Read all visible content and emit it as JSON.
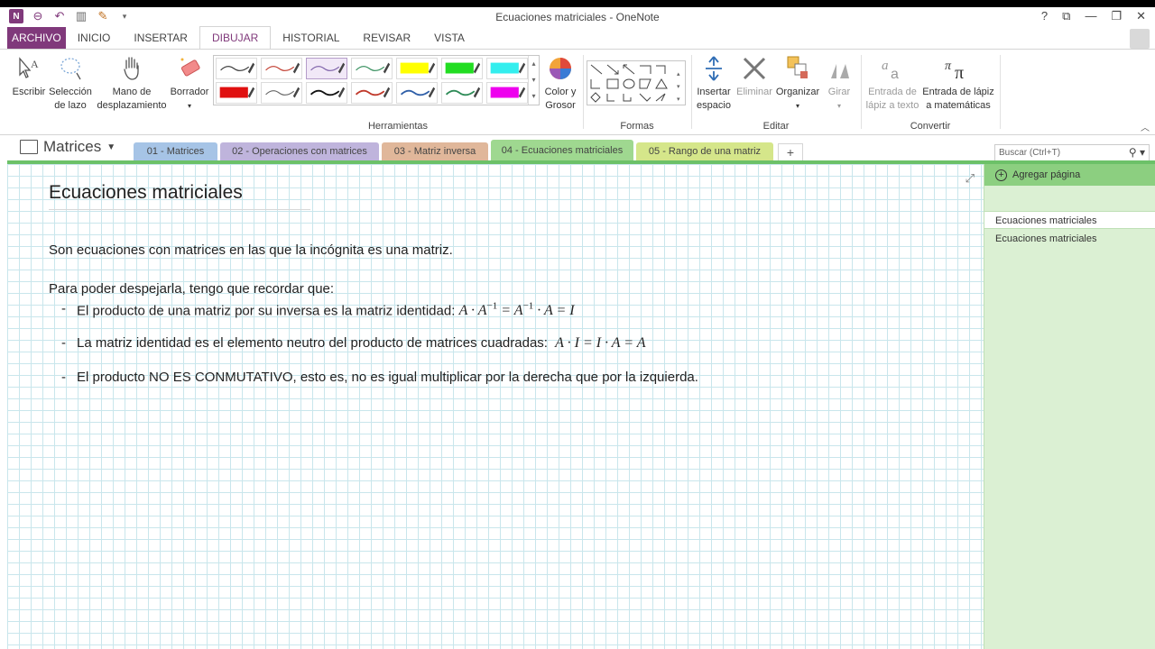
{
  "window": {
    "title": "Ecuaciones matriciales - OneNote",
    "logo_text": "N",
    "controls": [
      "?",
      "⧉",
      "—",
      "❐",
      "✕"
    ]
  },
  "ribbon_tabs": [
    "ARCHIVO",
    "INICIO",
    "INSERTAR",
    "DIBUJAR",
    "HISTORIAL",
    "REVISAR",
    "VISTA"
  ],
  "ribbon": {
    "escribir": "Escribir",
    "seleccion_1": "Selección",
    "seleccion_2": "de lazo",
    "mano_1": "Mano de",
    "mano_2": "desplazamiento",
    "borrador": "Borrador",
    "color_1": "Color y",
    "color_2": "Grosor",
    "insertar_1": "Insertar",
    "insertar_2": "espacio",
    "eliminar": "Eliminar",
    "organizar": "Organizar",
    "girar": "Girar",
    "entrada_texto_1": "Entrada de",
    "entrada_texto_2": "lápiz a texto",
    "entrada_mate_1": "Entrada de lápiz",
    "entrada_mate_2": "a matemáticas",
    "groups": {
      "herramientas": "Herramientas",
      "formas": "Formas",
      "editar": "Editar",
      "convertir": "Convertir"
    },
    "pens": [
      {
        "color": "#333333",
        "style": "line"
      },
      {
        "color": "#c0392b",
        "style": "line"
      },
      {
        "color": "#7b5ea7",
        "style": "line"
      },
      {
        "color": "#2e8b57",
        "style": "line"
      },
      {
        "color": "#ffff00",
        "style": "block"
      },
      {
        "color": "#22dd22",
        "style": "block"
      },
      {
        "color": "#33eeee",
        "style": "block"
      },
      {
        "color": "#e01010",
        "style": "block"
      },
      {
        "color": "#666666",
        "style": "line"
      },
      {
        "color": "#111111",
        "style": "thick"
      },
      {
        "color": "#c0392b",
        "style": "thick"
      },
      {
        "color": "#2f5fa8",
        "style": "thick"
      },
      {
        "color": "#2e8b57",
        "style": "thick"
      },
      {
        "color": "#ee00ee",
        "style": "block"
      }
    ]
  },
  "notebook": {
    "name": "Matrices",
    "sections": [
      {
        "label": "01 - Matrices",
        "color": "#a6c4e6"
      },
      {
        "label": "02 - Operaciones con matrices",
        "color": "#bfb4dc"
      },
      {
        "label": "03 - Matriz inversa",
        "color": "#e0b79a"
      },
      {
        "label": "04 - Ecuaciones matriciales",
        "color": "#9fd890"
      },
      {
        "label": "05 - Rango de una matriz",
        "color": "#d5e68a"
      }
    ],
    "add_section": "+",
    "search_placeholder": "Buscar (Ctrl+T)"
  },
  "page": {
    "title": "Ecuaciones matriciales",
    "intro": "Son ecuaciones con matrices en las que la incógnita es una matriz.",
    "lead": "Para poder despejarla, tengo que recordar que:",
    "bullets": [
      {
        "dash": "-",
        "text": "El producto de una matriz por su inversa es la matriz identidad:"
      },
      {
        "dash": "-",
        "text": "La matriz identidad es el elemento neutro del producto de matrices cuadradas:"
      },
      {
        "dash": "-",
        "text": "El producto NO ES CONMUTATIVO, esto es, no es igual multiplicar por la derecha que por la izquierda."
      }
    ]
  },
  "pages_pane": {
    "add_page": "Agregar página",
    "pages": [
      "Ecuaciones matriciales",
      "Ecuaciones matriciales"
    ]
  }
}
